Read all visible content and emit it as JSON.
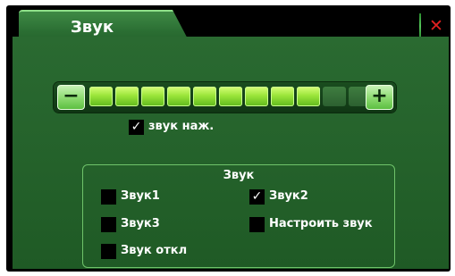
{
  "window": {
    "title": "Звук",
    "close_glyph": "✕",
    "accent": "#e02020",
    "panel_color": "#266330"
  },
  "volume": {
    "minus_glyph": "−",
    "plus_glyph": "+",
    "segments_total": 11,
    "segments_on": 9,
    "level": 0.82
  },
  "key_sound": {
    "label": "звук наж.",
    "checked": true,
    "check_glyph": "✓"
  },
  "group": {
    "title": "Звук",
    "options": [
      {
        "label": "Звук1",
        "checked": false
      },
      {
        "label": "Звук2",
        "checked": true
      },
      {
        "label": "Звук3",
        "checked": false
      },
      {
        "label": "Настроить звук",
        "checked": false
      },
      {
        "label": "Звук откл",
        "checked": false
      }
    ]
  }
}
